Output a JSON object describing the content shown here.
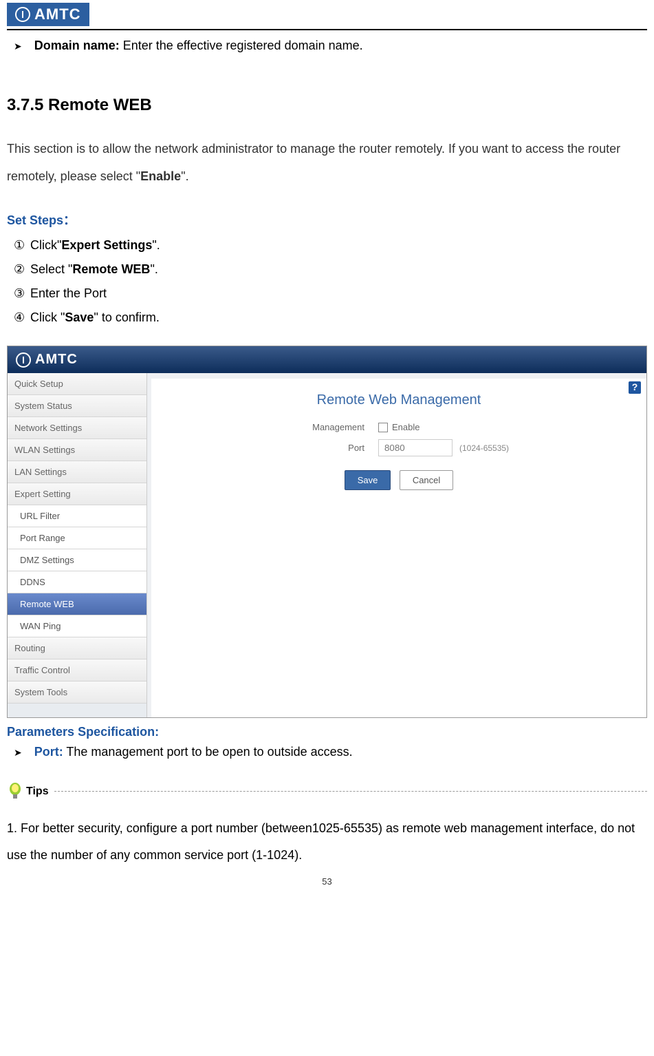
{
  "header": {
    "brand": "AMTC"
  },
  "domain_line": {
    "label": "Domain name:",
    "text": " Enter the effective registered domain name."
  },
  "section": {
    "title": "3.7.5 Remote WEB",
    "intro_part1": "This section is to allow the network administrator to manage the router remotely. If you want to access the router remotely, please select \"",
    "intro_bold": "Enable",
    "intro_part2": "\".",
    "set_steps_label": "Set Steps：",
    "steps": [
      {
        "pre": "Click\"",
        "bold": "Expert Settings",
        "post": "\"."
      },
      {
        "pre": "Select \"",
        "bold": "Remote WEB",
        "post": "\"."
      },
      {
        "pre": "Enter the Port",
        "bold": "",
        "post": ""
      },
      {
        "pre": "Click \"",
        "bold": "Save",
        "post": "\" to confirm."
      }
    ]
  },
  "router": {
    "top_brand": "AMTC",
    "help": "?",
    "panel_title": "Remote Web Management",
    "mgmt_label": "Management",
    "enable_label": "Enable",
    "port_label": "Port",
    "port_value": "8080",
    "port_hint": "(1024-65535)",
    "save_btn": "Save",
    "cancel_btn": "Cancel",
    "sidebar": [
      {
        "label": "Quick Setup",
        "sub": false,
        "active": false
      },
      {
        "label": "System Status",
        "sub": false,
        "active": false
      },
      {
        "label": "Network Settings",
        "sub": false,
        "active": false
      },
      {
        "label": "WLAN Settings",
        "sub": false,
        "active": false
      },
      {
        "label": "LAN Settings",
        "sub": false,
        "active": false
      },
      {
        "label": "Expert Setting",
        "sub": false,
        "active": false
      },
      {
        "label": "URL Filter",
        "sub": true,
        "active": false
      },
      {
        "label": "Port Range",
        "sub": true,
        "active": false
      },
      {
        "label": "DMZ Settings",
        "sub": true,
        "active": false
      },
      {
        "label": "DDNS",
        "sub": true,
        "active": false
      },
      {
        "label": "Remote WEB",
        "sub": true,
        "active": true
      },
      {
        "label": "WAN Ping",
        "sub": true,
        "active": false
      },
      {
        "label": "Routing",
        "sub": false,
        "active": false
      },
      {
        "label": "Traffic Control",
        "sub": false,
        "active": false
      },
      {
        "label": "System Tools",
        "sub": false,
        "active": false
      }
    ]
  },
  "params": {
    "heading": "Parameters Specification:",
    "port_label": "Port:",
    "port_text": " The management port to be open to outside access."
  },
  "tips": {
    "label": "Tips",
    "text": "1. For better security, configure a port number (between1025-65535) as remote web management interface, do not use the number of any common service port (1-1024)."
  },
  "page_number": "53"
}
